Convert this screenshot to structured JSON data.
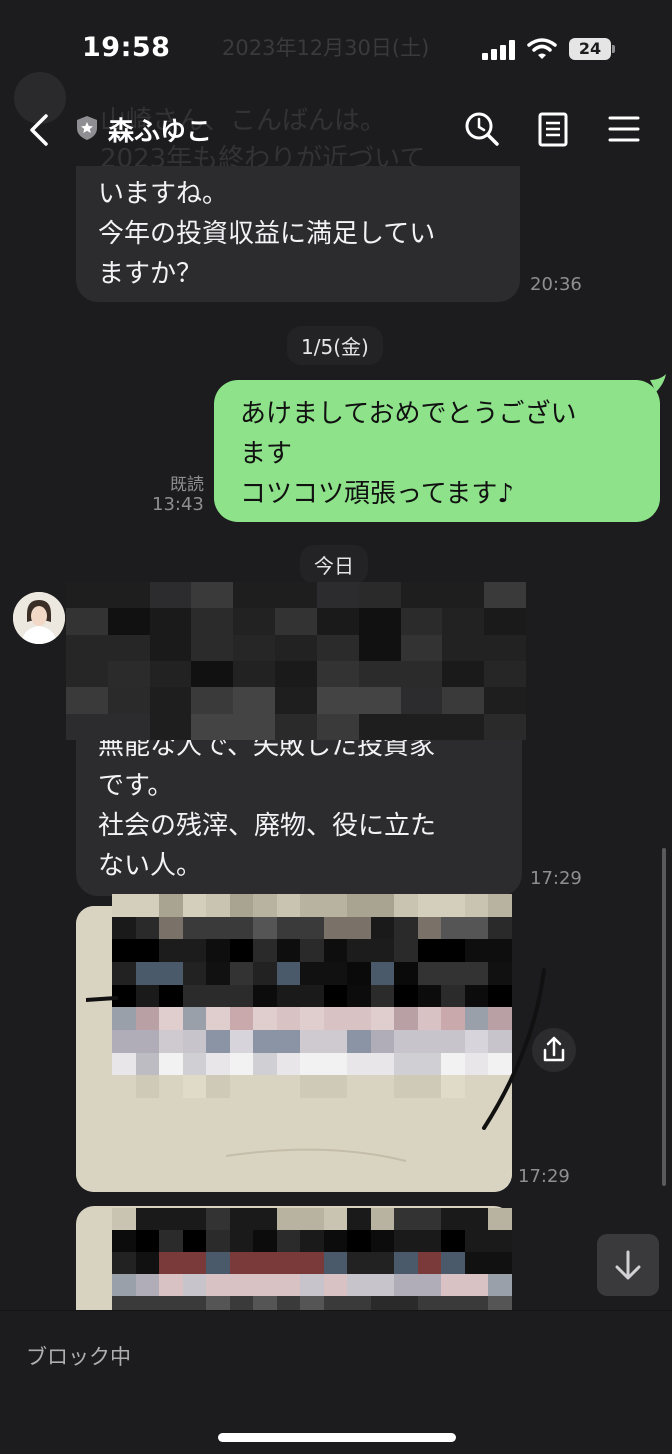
{
  "status_bar": {
    "time": "19:58",
    "date_ghost": "2023年12月30日(土)",
    "battery": "24"
  },
  "header": {
    "title": "森ふゆこ"
  },
  "ghost_preview": {
    "line1": "山崎さん、こんばんは。",
    "line2": "2023年も終わりが近づいて"
  },
  "messages": {
    "m1": {
      "lines": [
        "いますね。",
        "今年の投資収益に満足してい",
        "ますか？"
      ],
      "time": "20:36"
    },
    "sep1": "1/5(金)",
    "m2": {
      "lines": [
        "あけましておめでとうござい",
        "ます",
        "コツコツ頑張ってます♪"
      ],
      "read": "既読",
      "time": "13:43"
    },
    "sep2": "今日",
    "m3": {
      "lines": [
        "無能な人で、失敗した投資家",
        "です。",
        "社会の残滓、廃物、役に立た",
        "ない人。"
      ],
      "time": "17:29"
    },
    "m4": {
      "time": "17:29"
    }
  },
  "footer": {
    "label": "ブロック中"
  },
  "colors": {
    "background": "#1c1c1e",
    "bubble_in": "#2c2c2e",
    "bubble_out": "#8de28a"
  },
  "icons": [
    "back-icon",
    "shield-icon",
    "search-icon",
    "note-icon",
    "menu-icon",
    "share-icon",
    "arrow-down-icon"
  ]
}
